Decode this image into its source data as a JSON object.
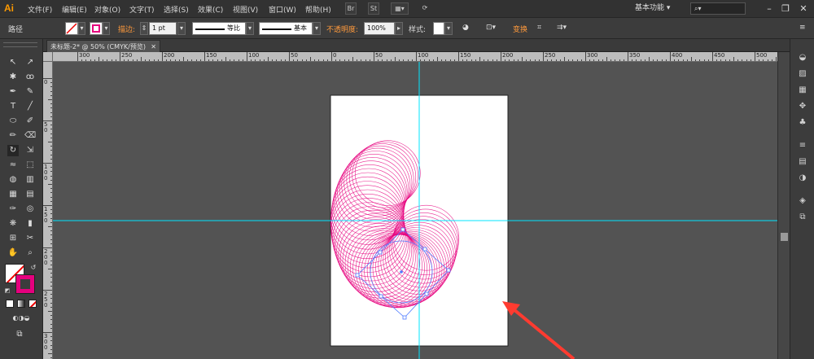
{
  "app": {
    "logo": "Ai"
  },
  "menubar": {
    "items": [
      "文件(F)",
      "编辑(E)",
      "对象(O)",
      "文字(T)",
      "选择(S)",
      "效果(C)",
      "视图(V)",
      "窗口(W)",
      "帮助(H)"
    ],
    "br_icon": "Br",
    "st_icon": "St",
    "workspace": "基本功能",
    "search_placeholder": ""
  },
  "controlbar": {
    "object_type": "路径",
    "stroke_label": "描边:",
    "stroke_weight": "1 pt",
    "profile_label": "等比",
    "brush_label": "基本",
    "opacity_label": "不透明度:",
    "opacity_value": "100%",
    "style_label": "样式:",
    "transform_label": "变换"
  },
  "document": {
    "tab_title": "未标题-2* @ 50% (CMYK/预览)"
  },
  "ruler": {
    "h_labels": [
      "300",
      "250",
      "200",
      "150",
      "100",
      "50",
      "0",
      "50",
      "100",
      "150",
      "200",
      "250",
      "300",
      "350",
      "400",
      "450",
      "500"
    ],
    "v_labels": [
      "0",
      "5 0",
      "1 0 0",
      "1 5 0",
      "2 0 0",
      "2 5 0",
      "3 0 0"
    ]
  },
  "colors": {
    "accent": "#ff9a00",
    "guide": "#00e5ff",
    "artwork": "#e6007e",
    "selection": "#4f7cff",
    "arrow": "#ff3b30"
  }
}
